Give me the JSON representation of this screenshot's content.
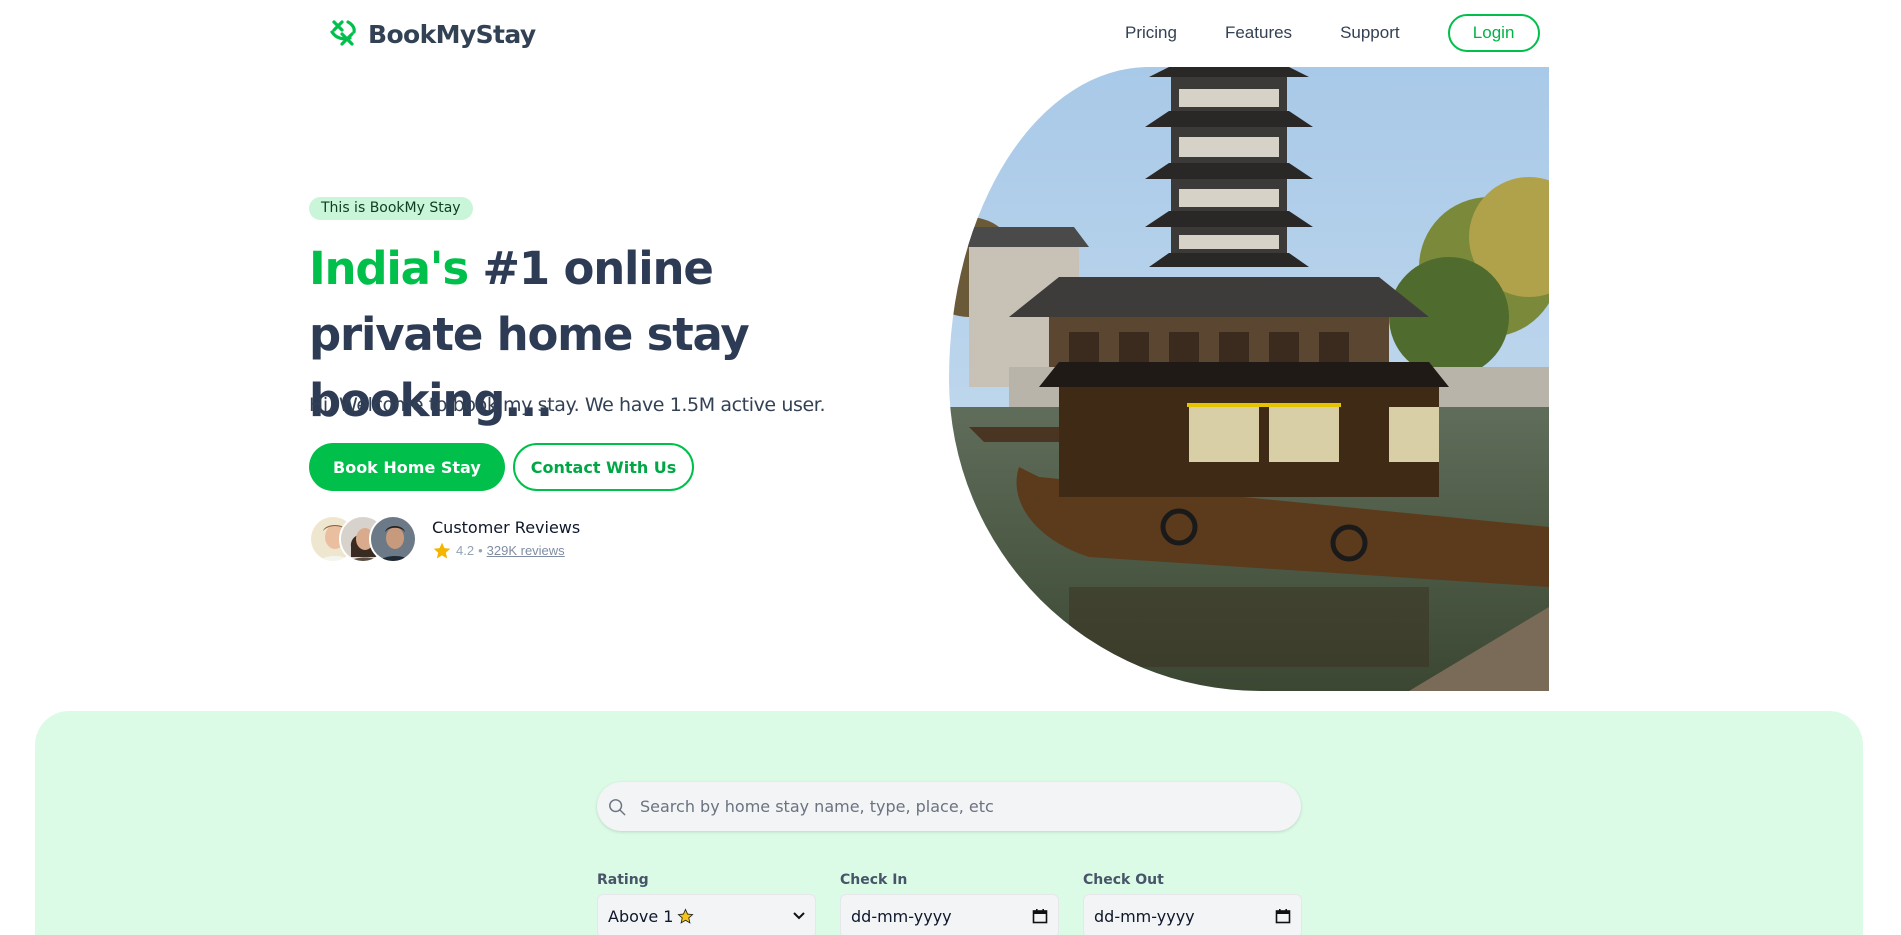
{
  "brand": {
    "name": "BookMyStay",
    "accent_color": "#00c04b",
    "text_color": "#2d3b55"
  },
  "nav": {
    "links": [
      "Pricing",
      "Features",
      "Support"
    ],
    "login_label": "Login"
  },
  "hero": {
    "badge": "This is BookMy Stay",
    "title_accent": "India's",
    "title_rest": " #1 online private home stay booking...",
    "subtitle": "Hi, Welcome to book my stay. We have 1.5M active user.",
    "primary_cta": "Book Home Stay",
    "secondary_cta": "Contact With Us",
    "reviews": {
      "title": "Customer Reviews",
      "rating": "4.2",
      "separator": "•",
      "count_link": "329K reviews"
    }
  },
  "search": {
    "placeholder": "Search by home stay name, type, place, etc",
    "filters": {
      "rating": {
        "label": "Rating",
        "value": "Above 1"
      },
      "check_in": {
        "label": "Check In",
        "value": "dd-mm-yyyy"
      },
      "check_out": {
        "label": "Check Out",
        "value": "dd-mm-yyyy"
      }
    }
  },
  "icons": {
    "logo": "leaf-logo-icon",
    "search": "search-icon",
    "star": "star-icon",
    "calendar": "calendar-icon",
    "chevron": "chevron-down-icon"
  }
}
